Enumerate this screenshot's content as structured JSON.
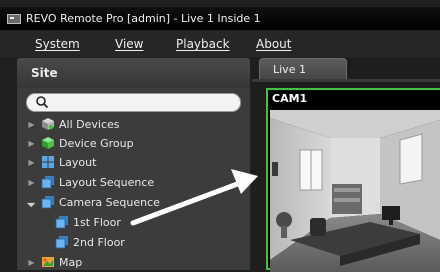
{
  "window": {
    "title": "REVO Remote Pro [admin] - Live 1  Inside 1"
  },
  "menu": [
    {
      "label": "System"
    },
    {
      "label": "View"
    },
    {
      "label": "Playback"
    },
    {
      "label": "About"
    }
  ],
  "site": {
    "title": "Site",
    "search": {
      "value": "",
      "placeholder": ""
    },
    "tree": [
      {
        "label": "All Devices",
        "icon": "all-devices-icon",
        "expander": "collapsed"
      },
      {
        "label": "Device Group",
        "icon": "device-group-icon",
        "expander": "collapsed"
      },
      {
        "label": "Layout",
        "icon": "layout-icon",
        "expander": "collapsed"
      },
      {
        "label": "Layout Sequence",
        "icon": "layout-sequence-icon",
        "expander": "collapsed"
      },
      {
        "label": "Camera Sequence",
        "icon": "camera-sequence-icon",
        "expander": "expanded"
      },
      {
        "label": "1st Floor",
        "icon": "sequence-item-icon",
        "expander": "none"
      },
      {
        "label": "2nd Floor",
        "icon": "sequence-item-icon",
        "expander": "none"
      },
      {
        "label": "Map",
        "icon": "map-icon",
        "expander": "collapsed"
      }
    ]
  },
  "tabs": [
    {
      "label": "Live  1"
    }
  ],
  "camera": {
    "label": "CAM1"
  },
  "colors": {
    "selected_border": "#3fc43f",
    "background": "#202020"
  }
}
